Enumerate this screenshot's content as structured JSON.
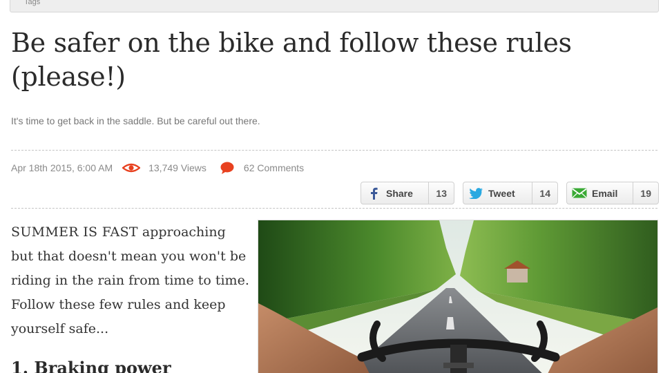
{
  "topbar": {
    "tag": "Tags"
  },
  "article": {
    "title": "Be safer on the bike and follow these rules (please!)",
    "subtitle": "It's time to get back in the saddle. But be careful out there.",
    "date": "Apr 18th 2015, 6:00 AM",
    "views": "13,749 Views",
    "comments": "62 Comments",
    "lead_caps": "SUMMER IS FAST",
    "lead_rest": " approaching but that doesn't mean you won't be riding in the rain from time to time. Follow these few rules and keep yourself safe...",
    "section_1": "1. Braking power"
  },
  "share": {
    "facebook": {
      "label": "Share",
      "count": "13",
      "icon": "facebook-icon",
      "color": "#3b5998"
    },
    "twitter": {
      "label": "Tweet",
      "count": "14",
      "icon": "twitter-icon",
      "color": "#29a9e1"
    },
    "email": {
      "label": "Email",
      "count": "19",
      "icon": "email-icon",
      "color": "#3aaa35"
    }
  },
  "colors": {
    "accent_red": "#e8411f",
    "meta_text": "#8a8a8a"
  }
}
